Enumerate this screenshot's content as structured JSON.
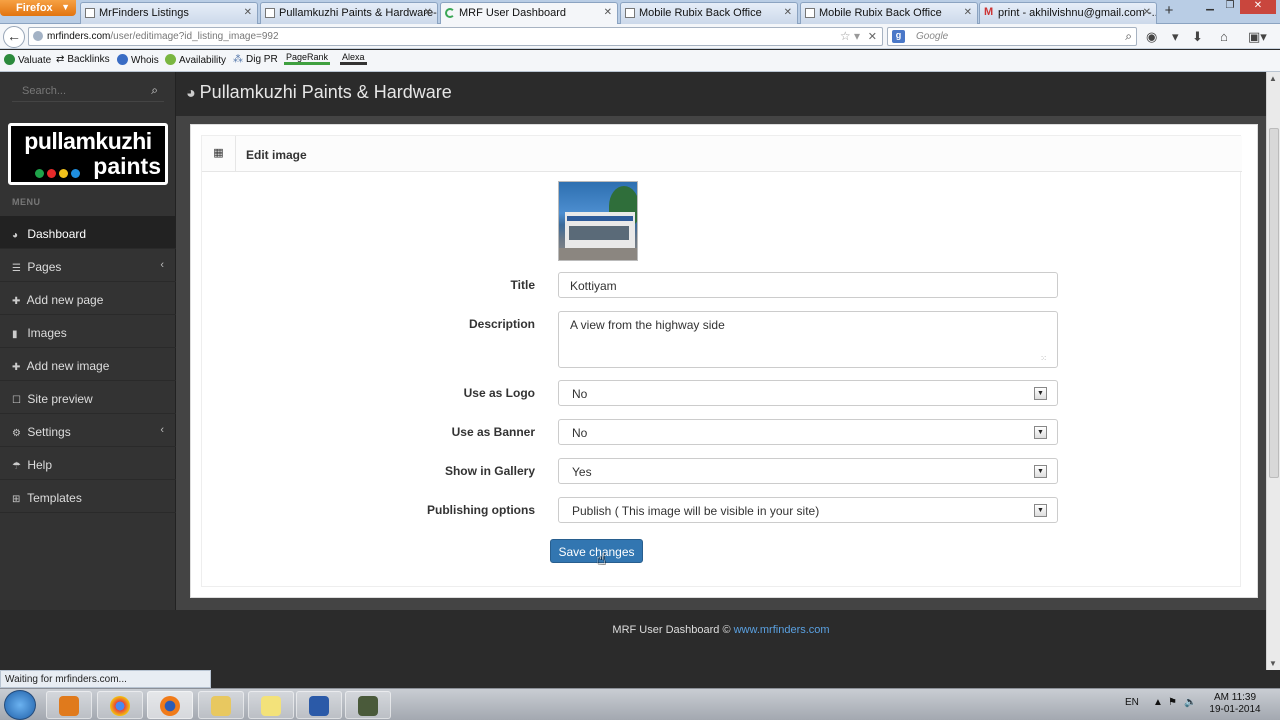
{
  "browser": {
    "menu_button": "Firefox",
    "tabs": [
      {
        "label": "MrFinders Listings"
      },
      {
        "label": "Pullamkuzhi Paints & Hardware-..."
      },
      {
        "label": "MRF User Dashboard"
      },
      {
        "label": "Mobile Rubix Back Office"
      },
      {
        "label": "Mobile Rubix Back Office"
      },
      {
        "label": "print - akhilvishnu@gmail.com -..."
      }
    ],
    "url_host": "mrfinders.com",
    "url_path": "/user/editimage?id_listing_image=992",
    "search_placeholder": "Google",
    "search_engine_letter": "g",
    "bookmarks": [
      "Valuate",
      "Backlinks",
      "Whois",
      "Availability",
      "Dig PR",
      "PageRank",
      "Alexa"
    ],
    "status_text": "Waiting for mrfinders.com..."
  },
  "sidebar": {
    "search_placeholder": "Search...",
    "logo_line1": "pullamkuzhi",
    "logo_line2": "paints",
    "logo_dot_colors": [
      "#1fa34a",
      "#e62a2a",
      "#f2c21b",
      "#1f8fe0"
    ],
    "menu_label": "MENU",
    "items": [
      {
        "label": "Dashboard",
        "icon": "dashboard-icon"
      },
      {
        "label": "Pages",
        "icon": "list-icon"
      },
      {
        "label": "Add new page",
        "icon": "plus-icon"
      },
      {
        "label": "Images",
        "icon": "file-icon"
      },
      {
        "label": "Add new image",
        "icon": "plus-icon"
      },
      {
        "label": "Site preview",
        "icon": "square-icon"
      },
      {
        "label": "Settings",
        "icon": "gear-icon"
      },
      {
        "label": "Help",
        "icon": "umbrella-icon"
      },
      {
        "label": "Templates",
        "icon": "windows-icon"
      }
    ]
  },
  "header": {
    "title": "Pullamkuzhi Paints & Hardware"
  },
  "panel": {
    "title": "Edit image"
  },
  "form": {
    "title_label": "Title",
    "title_value": "Kottiyam",
    "description_label": "Description",
    "description_value": "A view from the highway side",
    "logo_label": "Use as Logo",
    "logo_value": "No",
    "banner_label": "Use as Banner",
    "banner_value": "No",
    "gallery_label": "Show in Gallery",
    "gallery_value": "Yes",
    "publishing_label": "Publishing options",
    "publishing_value": "Publish ( This image will be visible in your site)",
    "save_label": "Save changes"
  },
  "footer": {
    "text": "MRF User Dashboard ©",
    "link": "www.mrfinders.com"
  },
  "taskbar": {
    "language": "EN",
    "time": "AM 11:39",
    "date": "19-01-2014"
  },
  "colors": {
    "accent": "#3276b1",
    "sidebar_bg": "#333333",
    "link": "#5aa0e0"
  }
}
